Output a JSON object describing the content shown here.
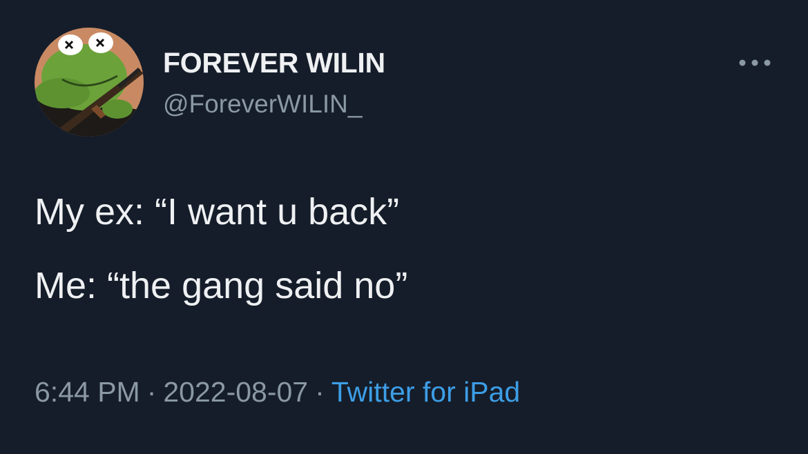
{
  "author": {
    "display_name": "FOREVER WILIN",
    "handle": "@ForeverWILIN_",
    "avatar_icon": "frog-avatar-icon"
  },
  "menu": {
    "icon": "more-options-icon"
  },
  "tweet": {
    "lines": [
      "My ex: “I want u back”",
      "Me: “the gang said no”"
    ]
  },
  "meta": {
    "time": "6:44 PM",
    "separator": "·",
    "date": "2022-08-07",
    "source": "Twitter for iPad"
  },
  "colors": {
    "background": "#151d2a",
    "primary_text": "#eef0f2",
    "secondary_text": "#8b98a5",
    "link": "#3d9ee6"
  }
}
